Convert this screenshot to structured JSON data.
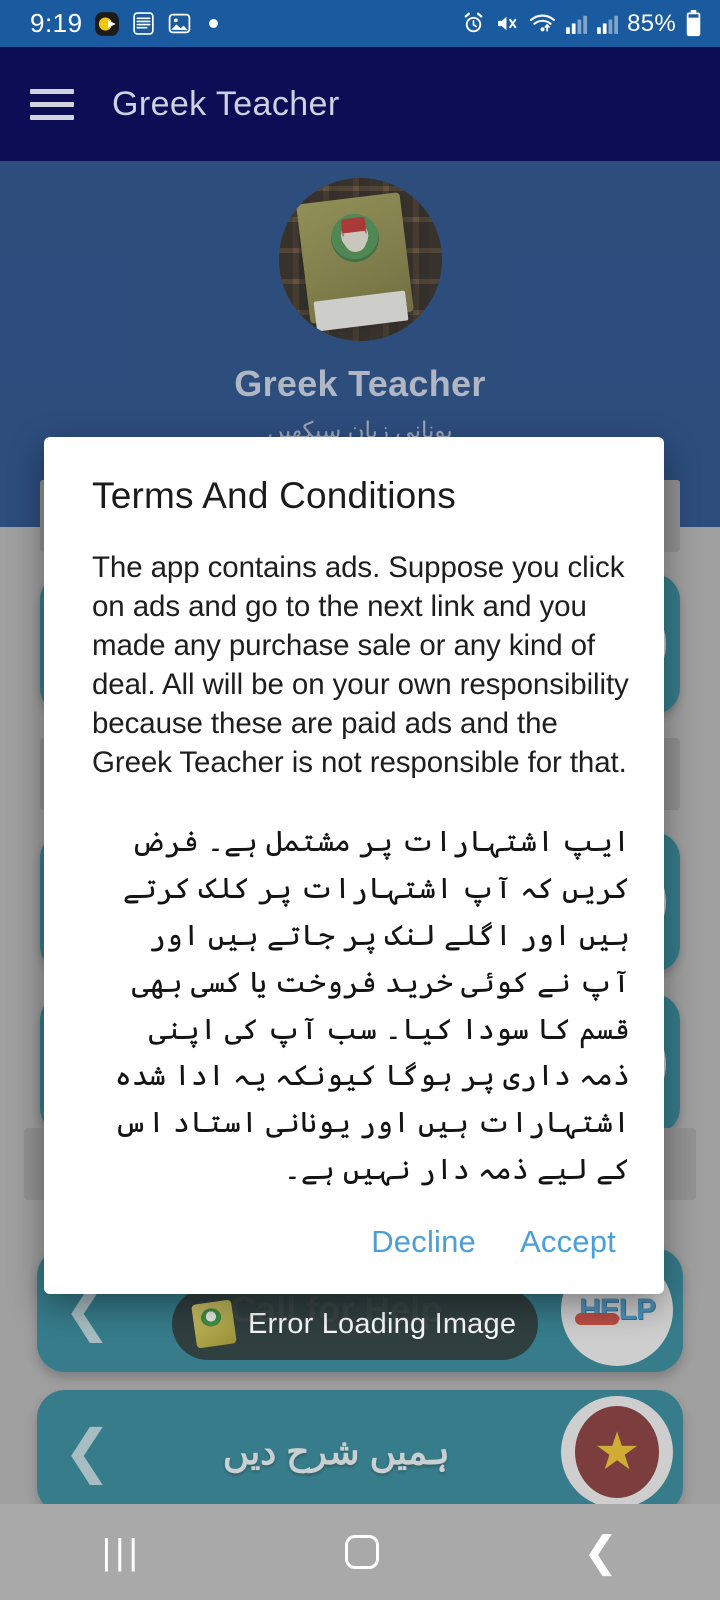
{
  "status_bar": {
    "time": "9:19",
    "left_icons": [
      "media-player-icon",
      "document-icon",
      "photo-icon",
      "dot-indicator"
    ],
    "right_icons": [
      "alarm-icon",
      "mute-vibrate-icon",
      "wifi-icon",
      "signal-bars-1-icon",
      "signal-bars-2-icon"
    ],
    "battery_percent": "85%",
    "background_color": "#1a5a9e"
  },
  "app_bar": {
    "menu_icon": "hamburger-menu-icon",
    "title": "Greek Teacher",
    "background_color": "#0d0d56"
  },
  "hero": {
    "logo_icon": "app-logo-book-icon",
    "app_name": "Greek Teacher",
    "subtitle": "یونانی زبان سیکھیں",
    "background_color": "#0d3b80"
  },
  "background_rows": [
    {
      "label": "",
      "avatar": "avatar-placeholder-icon",
      "chevron": "chevron-left-icon"
    },
    {
      "label": "",
      "avatar": "avatar-placeholder-icon",
      "chevron": "chevron-left-icon"
    },
    {
      "label": "",
      "avatar": "avatar-placeholder-icon",
      "chevron": "chevron-left-icon"
    }
  ],
  "foreground_rows": [
    {
      "label": "Call for Help",
      "avatar": "help-icon",
      "chevron": "chevron-left-icon"
    },
    {
      "label": "ہمیں شرح دیں",
      "avatar": "star-rating-icon",
      "chevron": "chevron-left-icon"
    }
  ],
  "toast": {
    "icon": "book-thumbnail-icon",
    "message": "Error Loading Image"
  },
  "dialog": {
    "title": "Terms And Conditions",
    "body_en": "The app contains ads. Suppose you click on ads and go to the next link and you made any purchase sale or any kind of deal. All will be on your own responsibility because these are paid ads and the Greek Teacher is not responsible for that.",
    "body_ur": "ایپ اشتہارات پر مشتمل ہے۔ فرض کریں کہ آپ اشتہارات پر کلک کرتے ہیں اور اگلے لنک پر جاتے ہیں اور آپ نے کوئی خرید فروخت یا کسی بھی قسم کا سودا کیا۔ سب آپ کی اپنی ذمہ داری پر ہوگا کیونکہ یہ ادا شدہ اشتہارات ہیں اور یونانی استاد اس کے لیے ذمہ دار نہیں ہے۔",
    "decline_label": "Decline",
    "accept_label": "Accept",
    "accent_color": "#4a9fd8",
    "background_color": "#ffffff"
  },
  "nav_bar": {
    "recents_icon": "recents-icon",
    "home_icon": "home-icon",
    "back_icon": "back-icon",
    "background_color": "#a9a9a9"
  }
}
